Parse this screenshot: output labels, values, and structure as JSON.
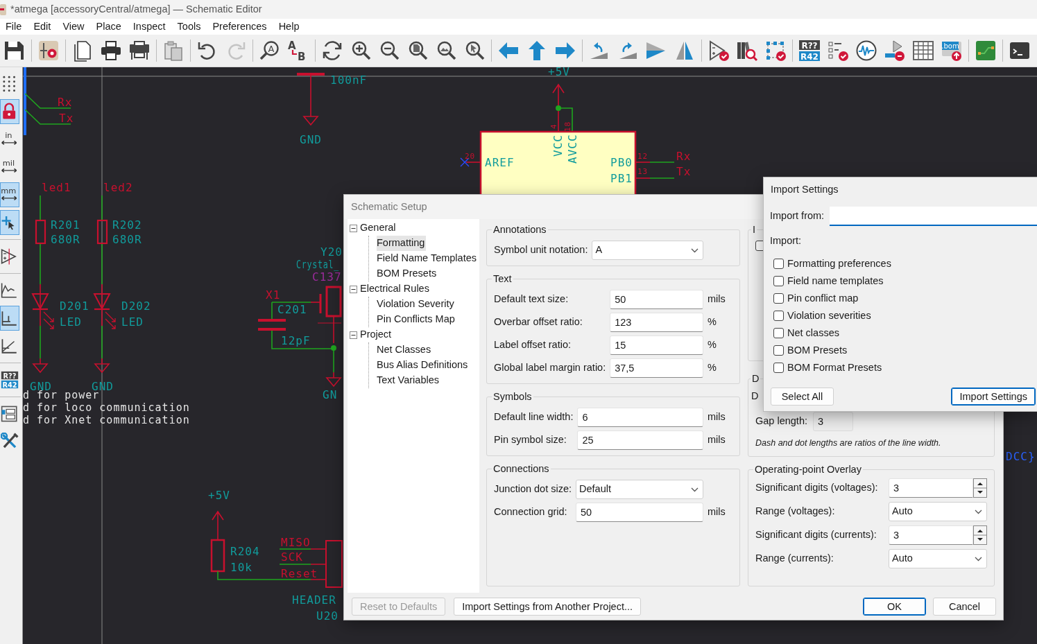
{
  "window": {
    "title": "*atmega [accessoryCentral/atmega] — Schematic Editor"
  },
  "menu": [
    "File",
    "Edit",
    "View",
    "Place",
    "Inspect",
    "Tools",
    "Preferences",
    "Help"
  ],
  "toolbar": [
    {
      "kind": "save"
    },
    {
      "kind": "separator"
    },
    {
      "kind": "symedit"
    },
    {
      "kind": "separator"
    },
    {
      "kind": "page"
    },
    {
      "kind": "print"
    },
    {
      "kind": "plot"
    },
    {
      "kind": "separator"
    },
    {
      "kind": "paste"
    },
    {
      "kind": "separator"
    },
    {
      "kind": "undo",
      "disabled": false
    },
    {
      "kind": "redo",
      "disabled": true
    },
    {
      "kind": "separator"
    },
    {
      "kind": "find",
      "letters": [
        "A"
      ]
    },
    {
      "kind": "replace",
      "letters": [
        "A",
        "B"
      ]
    },
    {
      "kind": "separator"
    },
    {
      "kind": "refresh"
    },
    {
      "kind": "zoomin"
    },
    {
      "kind": "zoomout"
    },
    {
      "kind": "zoomfit"
    },
    {
      "kind": "zoomobjects"
    },
    {
      "kind": "zoomselect"
    },
    {
      "kind": "separator"
    },
    {
      "kind": "left"
    },
    {
      "kind": "up"
    },
    {
      "kind": "right"
    },
    {
      "kind": "separator"
    },
    {
      "kind": "rotccw"
    },
    {
      "kind": "rotcw"
    },
    {
      "kind": "mirrorh"
    },
    {
      "kind": "mirrorv"
    },
    {
      "kind": "separator"
    },
    {
      "kind": "erc"
    },
    {
      "kind": "library"
    },
    {
      "kind": "fields"
    },
    {
      "kind": "separator"
    },
    {
      "kind": "annotate",
      "letters": [
        "R??",
        "R42"
      ]
    },
    {
      "kind": "checklist"
    },
    {
      "kind": "simulator"
    },
    {
      "kind": "pcblink"
    },
    {
      "kind": "table"
    },
    {
      "kind": "bom",
      "letters": [
        ".bom"
      ]
    },
    {
      "kind": "separator"
    },
    {
      "kind": "pcb"
    },
    {
      "kind": "separator"
    },
    {
      "kind": "terminal"
    }
  ],
  "left_toolbar": [
    {
      "kind": "grid",
      "selected": false
    },
    {
      "kind": "lock",
      "selected": true
    },
    {
      "kind": "units",
      "text": "in",
      "selected": false
    },
    {
      "kind": "units",
      "text": "mil",
      "selected": false
    },
    {
      "kind": "units",
      "text": "mm",
      "selected": true
    },
    {
      "kind": "cursor",
      "selected": true
    },
    {
      "kind": "separator"
    },
    {
      "kind": "opamp",
      "selected": false
    },
    {
      "kind": "separator"
    },
    {
      "kind": "chart",
      "selected": false
    },
    {
      "kind": "bars",
      "selected": true
    },
    {
      "kind": "graph",
      "selected": false
    },
    {
      "kind": "separator"
    },
    {
      "kind": "annotate",
      "letters": [
        "R??",
        "R42"
      ],
      "selected": false
    },
    {
      "kind": "separator"
    },
    {
      "kind": "hierarchy",
      "selected": false
    },
    {
      "kind": "tools",
      "selected": false
    }
  ],
  "schematic": {
    "texts": [
      {
        "text": "100nF",
        "kind": "value"
      },
      {
        "text": "GND",
        "kind": "value"
      },
      {
        "text": "+5V",
        "kind": "value"
      },
      {
        "text": "4",
        "kind": "pin"
      },
      {
        "text": "18",
        "kind": "pin"
      },
      {
        "text": "VCC",
        "kind": "value"
      },
      {
        "text": "AVCC",
        "kind": "value"
      },
      {
        "text": "AREF",
        "kind": "value"
      },
      {
        "text": "PB0",
        "kind": "value"
      },
      {
        "text": "PB1",
        "kind": "value"
      },
      {
        "text": "20",
        "kind": "pin"
      },
      {
        "text": "12",
        "kind": "pin"
      },
      {
        "text": "13",
        "kind": "pin"
      },
      {
        "text": "Rx",
        "kind": "net"
      },
      {
        "text": "Tx",
        "kind": "net"
      },
      {
        "text": "Rx",
        "kind": "net"
      },
      {
        "text": "Tx",
        "kind": "net"
      },
      {
        "text": "led1",
        "kind": "net"
      },
      {
        "text": "led2",
        "kind": "net"
      },
      {
        "text": "R201",
        "kind": "value"
      },
      {
        "text": "680R",
        "kind": "value"
      },
      {
        "text": "R202",
        "kind": "value"
      },
      {
        "text": "680R",
        "kind": "value"
      },
      {
        "text": "D201",
        "kind": "value"
      },
      {
        "text": "LED",
        "kind": "value"
      },
      {
        "text": "D202",
        "kind": "value"
      },
      {
        "text": "LED",
        "kind": "value"
      },
      {
        "text": "GND",
        "kind": "value"
      },
      {
        "text": "GND",
        "kind": "value"
      },
      {
        "text": "Y20",
        "kind": "value"
      },
      {
        "text": "Crystal_",
        "kind": "value"
      },
      {
        "text": "C137",
        "kind": "field"
      },
      {
        "text": "X1",
        "kind": "net"
      },
      {
        "text": "C201",
        "kind": "value"
      },
      {
        "text": "12pF",
        "kind": "value"
      },
      {
        "text": "GN",
        "kind": "value"
      },
      {
        "text": "d for power",
        "kind": "note"
      },
      {
        "text": "d for loco communication",
        "kind": "note"
      },
      {
        "text": "d for Xnet communication",
        "kind": "note"
      },
      {
        "text": "+5V",
        "kind": "value"
      },
      {
        "text": "R204",
        "kind": "value"
      },
      {
        "text": "10k",
        "kind": "value"
      },
      {
        "text": "MISO",
        "kind": "net"
      },
      {
        "text": "SCK",
        "kind": "net"
      },
      {
        "text": "Reset",
        "kind": "net"
      },
      {
        "text": "HEADER",
        "kind": "value"
      },
      {
        "text": "U20",
        "kind": "value"
      },
      {
        "text": "DCC}",
        "kind": "bus"
      }
    ]
  },
  "setup": {
    "title": "Schematic Setup",
    "tree": [
      {
        "label": "General",
        "expanded": true,
        "selected": false,
        "children": [
          {
            "label": "Formatting",
            "selected": true
          },
          {
            "label": "Field Name Templates",
            "selected": false
          },
          {
            "label": "BOM Presets",
            "selected": false
          }
        ]
      },
      {
        "label": "Electrical Rules",
        "expanded": true,
        "selected": false,
        "children": [
          {
            "label": "Violation Severity",
            "selected": false
          },
          {
            "label": "Pin Conflicts Map",
            "selected": false
          }
        ]
      },
      {
        "label": "Project",
        "expanded": true,
        "selected": false,
        "children": [
          {
            "label": "Net Classes",
            "selected": false
          },
          {
            "label": "Bus Alias Definitions",
            "selected": false
          },
          {
            "label": "Text Variables",
            "selected": false
          }
        ]
      }
    ],
    "groups": [
      {
        "title": "Annotations",
        "fields": [
          {
            "label": "Symbol unit notation:",
            "kind": "dropdown",
            "value": "A"
          }
        ]
      },
      {
        "title": "Text",
        "fields": [
          {
            "label": "Default text size:",
            "kind": "input",
            "value": "50",
            "unit": "mils"
          },
          {
            "label": "Overbar offset ratio:",
            "kind": "input",
            "value": "123",
            "unit": "%"
          },
          {
            "label": "Label offset ratio:",
            "kind": "input",
            "value": "15",
            "unit": "%"
          },
          {
            "label": "Global label margin ratio:",
            "kind": "input",
            "value": "37,5",
            "unit": "%"
          }
        ]
      },
      {
        "title": "Symbols",
        "fields": [
          {
            "label": "Default line width:",
            "kind": "input",
            "value": "6",
            "unit": "mils"
          },
          {
            "label": "Pin symbol size:",
            "kind": "input",
            "value": "25",
            "unit": "mils"
          }
        ]
      },
      {
        "title": "Connections",
        "fields": [
          {
            "label": "Junction dot size:",
            "kind": "dropdown",
            "value": "Default"
          },
          {
            "label": "Connection grid:",
            "kind": "input",
            "value": "50",
            "unit": "mils"
          }
        ]
      }
    ],
    "partial_group": {
      "title": "I",
      "checked": false
    },
    "dash_group": {
      "title": "D",
      "label": "D",
      "gap_label": "Gap length:",
      "gap_value": "3",
      "note": "Dash and dot lengths are ratios of the line width."
    },
    "overlay": {
      "title": "Operating-point Overlay",
      "fields": [
        {
          "label": "Significant digits (voltages):",
          "kind": "spin",
          "value": "3"
        },
        {
          "label": "Range (voltages):",
          "kind": "dropdown",
          "value": "Auto"
        },
        {
          "label": "Significant digits (currents):",
          "kind": "spin",
          "value": "3"
        },
        {
          "label": "Range (currents):",
          "kind": "dropdown",
          "value": "Auto"
        }
      ]
    },
    "buttons": [
      {
        "label": "Reset to Defaults",
        "disabled": true,
        "default": false
      },
      {
        "label": "Import Settings from Another Project...",
        "disabled": false,
        "default": false
      },
      {
        "label": "OK",
        "disabled": false,
        "default": true
      },
      {
        "label": "Cancel",
        "disabled": false,
        "default": false
      }
    ]
  },
  "import": {
    "title": "Import Settings",
    "from_label": "Import from:",
    "import_label": "Import:",
    "options": [
      {
        "label": "Formatting preferences",
        "checked": false
      },
      {
        "label": "Field name templates",
        "checked": false
      },
      {
        "label": "Pin conflict map",
        "checked": false
      },
      {
        "label": "Violation severities",
        "checked": false
      },
      {
        "label": "Net classes",
        "checked": false
      },
      {
        "label": "BOM Presets",
        "checked": false
      },
      {
        "label": "BOM Format Presets",
        "checked": false
      }
    ],
    "buttons": [
      {
        "label": "Select All",
        "default": false
      },
      {
        "label": "Import Settings",
        "default": true
      }
    ]
  }
}
